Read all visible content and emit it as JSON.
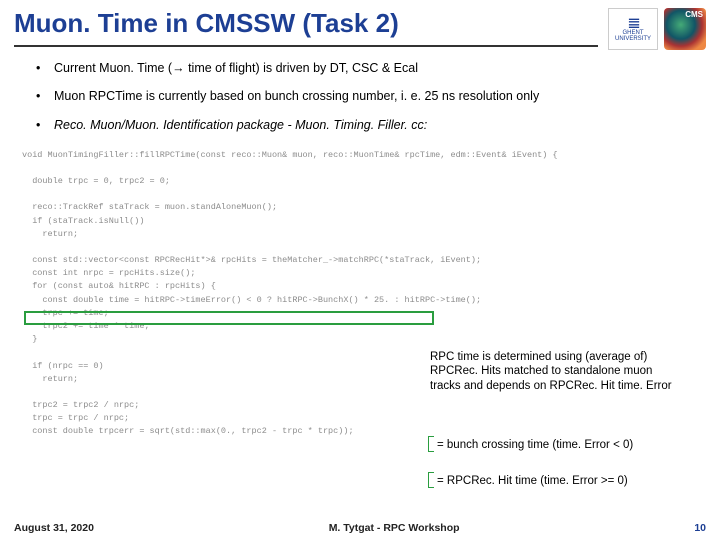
{
  "title": "Muon. Time in CMSSW (Task 2)",
  "logos": {
    "ghent": "GHENT\nUNIVERSITY",
    "cms": "CMS"
  },
  "bullets": [
    "Current Muon. Time (→ time of flight) is driven by DT, CSC & Ecal",
    "Muon RPCTime is currently based on bunch crossing number, i. e. 25 ns resolution only",
    "Reco. Muon/Muon. Identification package - Muon. Timing. Filler. cc:"
  ],
  "code": "void MuonTimingFiller::fillRPCTime(const reco::Muon& muon, reco::MuonTime& rpcTime, edm::Event& iEvent) {\n\n  double trpc = 0, trpc2 = 0;\n\n  reco::TrackRef staTrack = muon.standAloneMuon();\n  if (staTrack.isNull())\n    return;\n\n  const std::vector<const RPCRecHit*>& rpcHits = theMatcher_->matchRPC(*staTrack, iEvent);\n  const int nrpc = rpcHits.size();\n  for (const auto& hitRPC : rpcHits) {\n    const double time = hitRPC->timeError() < 0 ? hitRPC->BunchX() * 25. : hitRPC->time();\n    trpc += time;\n    trpc2 += time * time;\n  }\n\n  if (nrpc == 0)\n    return;\n\n  trpc2 = trpc2 / nrpc;\n  trpc = trpc / nrpc;\n  const double trpcerr = sqrt(std::max(0., trpc2 - trpc * trpc));",
  "annotations": {
    "a1": "RPC time is determined using (average of) RPCRec. Hits matched to standalone muon tracks and depends on RPCRec. Hit time. Error",
    "a2": "= bunch crossing time (time. Error < 0)",
    "a3": "= RPCRec. Hit time (time. Error >= 0)"
  },
  "footer": {
    "date": "August 31, 2020",
    "mid": "M. Tytgat - RPC Workshop",
    "page": "10"
  }
}
